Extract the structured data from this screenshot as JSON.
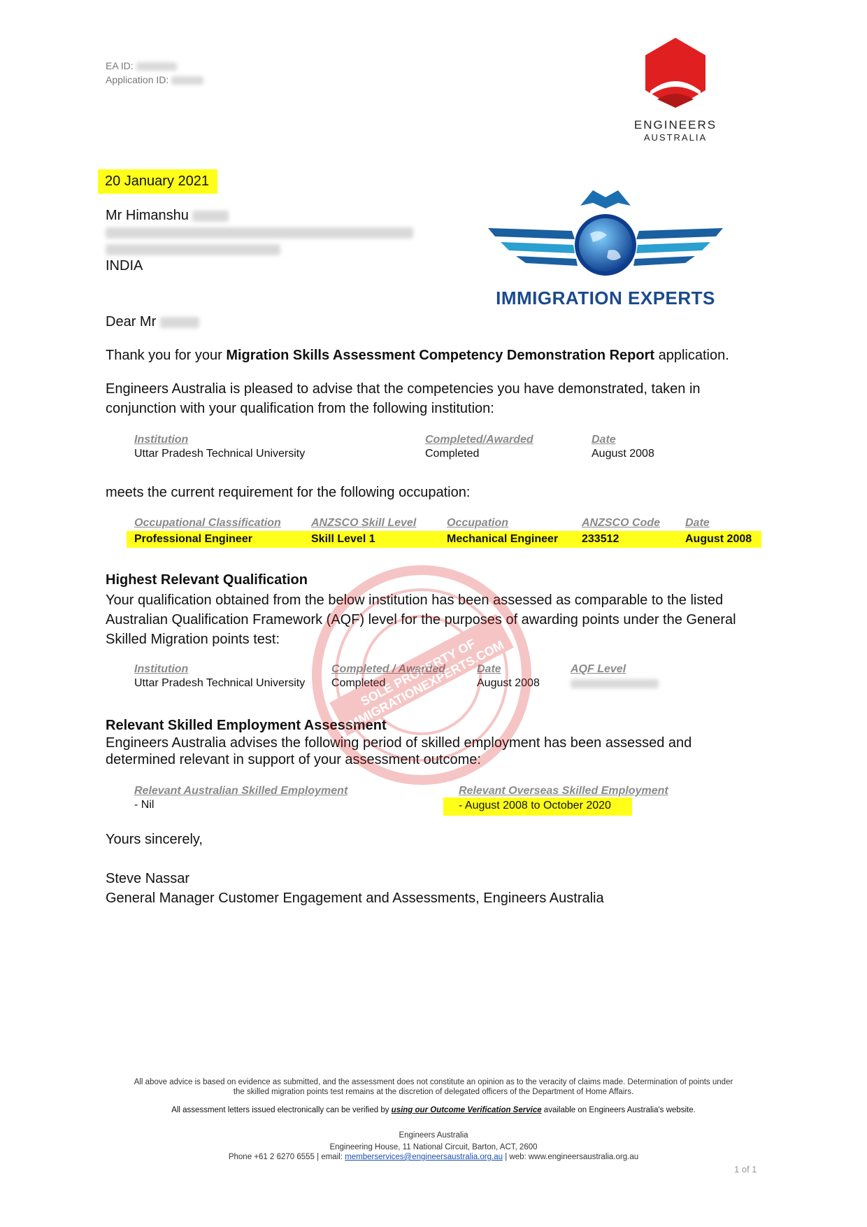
{
  "header": {
    "ea_id_label": "EA ID:",
    "application_id_label": "Application ID:"
  },
  "logos": {
    "ea_name_line1": "ENGINEERS",
    "ea_name_line2": "AUSTRALIA",
    "watermark_logo_text": "IMMIGRATION EXPERTS",
    "stamp_text": "SOLE PROPERTY OF IMMIGRATIONEXPERTS.COM"
  },
  "letter": {
    "date": "20 January 2021",
    "recipient_name": "Mr Himanshu",
    "recipient_country": "INDIA",
    "salutation": "Dear Mr",
    "thanks_pre": "Thank you for your ",
    "thanks_bold": "Migration Skills Assessment Competency Demonstration Report",
    "thanks_post": " application.",
    "advise_line1": "Engineers Australia is pleased to advise that the competencies you have demonstrated, taken in",
    "advise_line2": "conjunction with your qualification from the following institution:",
    "meets_text": "meets the current requirement for the following occupation:"
  },
  "institution_table": {
    "headers": [
      "Institution",
      "Completed/Awarded",
      "Date"
    ],
    "row": [
      "Uttar Pradesh Technical University",
      "Completed",
      "August 2008"
    ]
  },
  "occupation_table": {
    "headers": [
      "Occupational Classification",
      "ANZSCO Skill Level",
      "Occupation",
      "ANZSCO Code",
      "Date"
    ],
    "row": [
      "Professional Engineer",
      "Skill Level 1",
      "Mechanical Engineer",
      "233512",
      "August 2008"
    ]
  },
  "qualification": {
    "title": "Highest Relevant Qualification",
    "text_line1": "Your qualification obtained from the below institution has  been assessed as comparable to the listed",
    "text_line2": "Australian Qualification Framework (AQF) level for the purposes of awarding points under the General",
    "text_line3": "Skilled Migration points test:",
    "headers": [
      "Institution",
      "Completed / Awarded",
      "Date",
      "AQF Level"
    ],
    "row": [
      "Uttar Pradesh Technical University",
      "Completed",
      "August 2008"
    ]
  },
  "employment": {
    "title": "Relevant Skilled Employment Assessment",
    "text_line1": "Engineers Australia advises the following period of skilled employment has been assessed and",
    "text_line2": "determined relevant in support of your assessment outcome:",
    "aus_header": "Relevant Australian Skilled Employment",
    "aus_value": "- Nil",
    "overseas_header": "Relevant Overseas Skilled Employment",
    "overseas_value": "- August 2008 to October 2020"
  },
  "closing": {
    "signoff": "Yours sincerely,",
    "signer_name": "Steve Nassar",
    "signer_title": "General Manager Customer Engagement and Assessments, Engineers Australia"
  },
  "footer": {
    "disclaimer_line1": "All above advice is based on evidence as submitted, and the assessment does not constitute an opinion as to the veracity of claims made. Determination of points under",
    "disclaimer_line2": "the skilled migration points test remains at the discretion of delegated officers of the Department of Home Affairs.",
    "verify_pre": "All assessment letters issued electronically can be verified by ",
    "verify_link": "using our Outcome Verification Service",
    "verify_post": " available on Engineers Australia's website.",
    "org_name": "Engineers Australia",
    "org_address": "Engineering House, 11 National Circuit, Barton, ACT, 2600",
    "phone_pre": "Phone +61 2 6270 6555 | email: ",
    "email": "memberservices@engineersaustralia.org.au",
    "web": " | web: www.engineersaustralia.org.au",
    "page_number": "1 of 1"
  },
  "colors": {
    "highlight": "#ffff1a",
    "ea_red": "#e02020",
    "ie_blue": "#1a4a8c",
    "label_gray": "#8a8a8a"
  }
}
